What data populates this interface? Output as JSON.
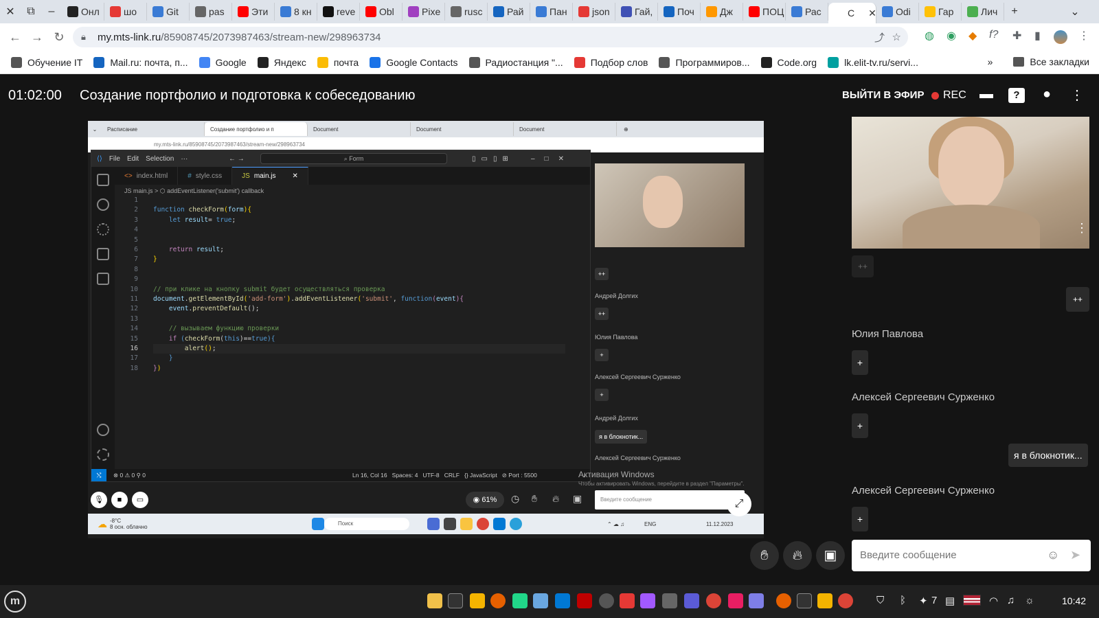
{
  "browser": {
    "tabs": [
      {
        "label": "Онл",
        "color": "#222"
      },
      {
        "label": "шо",
        "color": "#e53935"
      },
      {
        "label": "Git",
        "color": "#3a7bd5"
      },
      {
        "label": "pas",
        "color": "#666"
      },
      {
        "label": "Эти",
        "color": "#ff0000"
      },
      {
        "label": "8 кн",
        "color": "#3a7bd5"
      },
      {
        "label": "reve",
        "color": "#111"
      },
      {
        "label": "Obl",
        "color": "#ff0000"
      },
      {
        "label": "Pixe",
        "color": "#a040c0"
      },
      {
        "label": "rusc",
        "color": "#666"
      },
      {
        "label": "Рай",
        "color": "#1565c0"
      },
      {
        "label": "Пан",
        "color": "#3a7bd5"
      },
      {
        "label": "json",
        "color": "#e53935"
      },
      {
        "label": "Гай,",
        "color": "#3f51b5"
      },
      {
        "label": "Поч",
        "color": "#1565c0"
      },
      {
        "label": "Дж",
        "color": "#ff9800"
      },
      {
        "label": "ПОЦ",
        "color": "#ff0000"
      },
      {
        "label": "Рас",
        "color": "#3a7bd5"
      },
      {
        "label": "С",
        "color": "#fff"
      },
      {
        "label": "Odi",
        "color": "#3a7bd5"
      },
      {
        "label": "Гар",
        "color": "#ffc107"
      },
      {
        "label": "Лич",
        "color": "#4caf50"
      }
    ],
    "url_host": "my.mts-link.ru",
    "url_path": "/85908745/2073987463/stream-new/298963734",
    "bookmarks": [
      {
        "label": "Обучение IT",
        "color": "#555"
      },
      {
        "label": "Mail.ru: почта, п...",
        "color": "#1565c0"
      },
      {
        "label": "Google",
        "color": "#4285f4"
      },
      {
        "label": "Яндекс",
        "color": "#222"
      },
      {
        "label": "почта",
        "color": "#fbbc05"
      },
      {
        "label": "Google Contacts",
        "color": "#1a73e8"
      },
      {
        "label": "Радиостанция \"...",
        "color": "#555"
      },
      {
        "label": "Подбор слов",
        "color": "#e53935"
      },
      {
        "label": "Программиров...",
        "color": "#555"
      },
      {
        "label": "Code.org",
        "color": "#222"
      },
      {
        "label": "lk.elit-tv.ru/servi...",
        "color": "#00a0a0"
      }
    ],
    "all_bookmarks": "Все закладки",
    "more": "»"
  },
  "stream": {
    "timer": "01:02:00",
    "title": "Создание портфолио и подготовка к собеседованию",
    "go_live": "ВЫЙТИ В ЭФИР",
    "rec": "REC"
  },
  "share": {
    "tabs": [
      "Расписание",
      "Создание портфолио и п",
      "Document",
      "Document",
      "Document"
    ],
    "addr": "my.mts-link.ru/85908745/2073987463/stream-new/298963734",
    "vscode": {
      "menu": [
        "File",
        "Edit",
        "Selection",
        "···"
      ],
      "command": "Form",
      "tabs": [
        "index.html",
        "style.css",
        "main.js"
      ],
      "breadcrumb": "JS main.js > ⬡ addEventListener('submit') callback",
      "status_left": "⊗ 0 ⚠ 0   ⚲ 0",
      "status_right": "Ln 16, Col 16   Spaces: 4   UTF-8   CRLF   {} JavaScript   ⊘ Port : 5500"
    },
    "zoom": "61%",
    "side_names": [
      "Андрей Долгих",
      "Юлия Павлова",
      "Алексей Сергеевич Сурженко",
      "Андрей Долгих",
      "Алексей Сергеевич Сурженко"
    ],
    "side_plus": [
      "++",
      "++",
      "+",
      "+"
    ],
    "side_bubble": "я в блокнотик...",
    "side_input": "Введите сообщение",
    "watermark_title": "Активация Windows",
    "watermark_text": "Чтобы активировать Windows, перейдите в раздел \"Параметры\".",
    "taskbar_weather": "-8°C",
    "taskbar_weather2": "8 осн. облачно",
    "taskbar_search": "Поиск",
    "taskbar_lang": "ENG",
    "taskbar_date": "11.12.2023"
  },
  "side": {
    "plus_top": "++",
    "names": [
      "Юлия Павлова",
      "Алексей Сергеевич Сурженко",
      "Алексей Сергеевич Сурженко"
    ],
    "bubble": "я в блокнотик...",
    "input_placeholder": "Введите сообщение"
  },
  "os": {
    "clock": "10:42",
    "num": "7"
  }
}
